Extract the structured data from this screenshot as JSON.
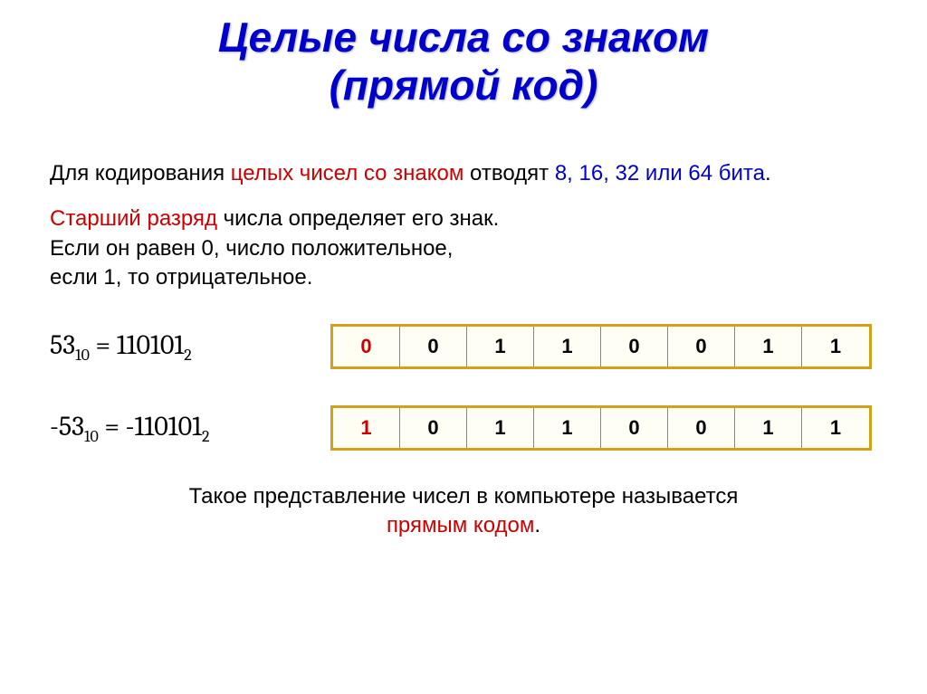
{
  "title": {
    "line1": "Целые числа со знаком",
    "line2": "(прямой код)"
  },
  "para1": {
    "t1": "Для кодирования ",
    "t2": "целых чисел со знаком",
    "t3": " отводят ",
    "t4": "8, 16, 32 или 64 бита",
    "t5": "."
  },
  "para2": {
    "t1": "Старший разряд",
    "t2": " числа определяет его знак.",
    "t3": "Если он равен 0, число положительное,",
    "t4": "если 1, то отрицательное."
  },
  "example1": {
    "num_base": "53",
    "num_sub": "10",
    "eq": " = ",
    "bin": "110101",
    "bin_sub": "2",
    "bits": [
      "0",
      "0",
      "1",
      "1",
      "0",
      "0",
      "1",
      "1"
    ]
  },
  "example2": {
    "num_base": "-53",
    "num_sub": "10",
    "eq": " = ",
    "bin": "-110101",
    "bin_sub": "2",
    "bits": [
      "1",
      "0",
      "1",
      "1",
      "0",
      "0",
      "1",
      "1"
    ]
  },
  "footer": {
    "t1": "Такое представление чисел в компьютере называется",
    "t2": "прямым кодом",
    "t3": "."
  }
}
